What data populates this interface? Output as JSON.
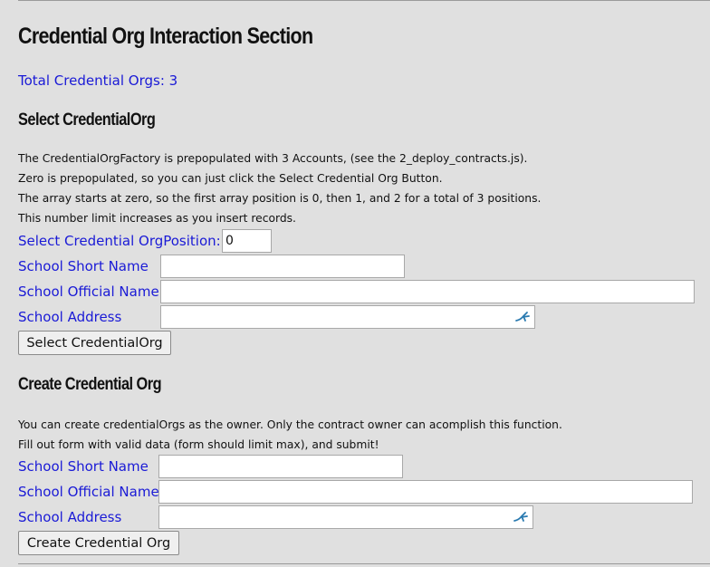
{
  "section": {
    "title": "Credential Org Interaction Section",
    "total_label": "Total Credential Orgs: 3"
  },
  "select": {
    "heading": "Select CredentialOrg",
    "paragraphs": [
      "The CredentialOrgFactory is prepopulated with 3 Accounts, (see the 2_deploy_contracts.js).",
      "Zero is prepopulated, so you can just click the Select Credential Org Button.",
      "The array starts at zero, so the first array position is 0, then 1, and 2 for a total of 3 positions.",
      "This number limit increases as you insert records."
    ],
    "position_label": "Select Credential OrgPosition:",
    "position_value": "0",
    "short_name_label": "School Short Name",
    "short_name_value": "",
    "official_name_label": "School Official Name",
    "official_name_value": "",
    "address_label": "School Address",
    "address_value": "",
    "button_label": "Select CredentialOrg"
  },
  "create": {
    "heading": "Create Credential Org",
    "paragraphs": [
      "You can create credentialOrgs as the owner. Only the contract owner can acomplish this function.",
      "Fill out form with valid data (form should limit max), and submit!"
    ],
    "short_name_label": "School Short Name",
    "short_name_value": "",
    "official_name_label": "School Official Name",
    "official_name_value": "",
    "address_label": "School Address",
    "address_value": "",
    "button_label": "Create Credential Org"
  },
  "icons": {
    "address_autofill": "autofill-icon"
  },
  "colors": {
    "link_blue": "#1a1ad6",
    "background": "#e0e0e0",
    "autofill_icon": "#2a7ab0"
  }
}
